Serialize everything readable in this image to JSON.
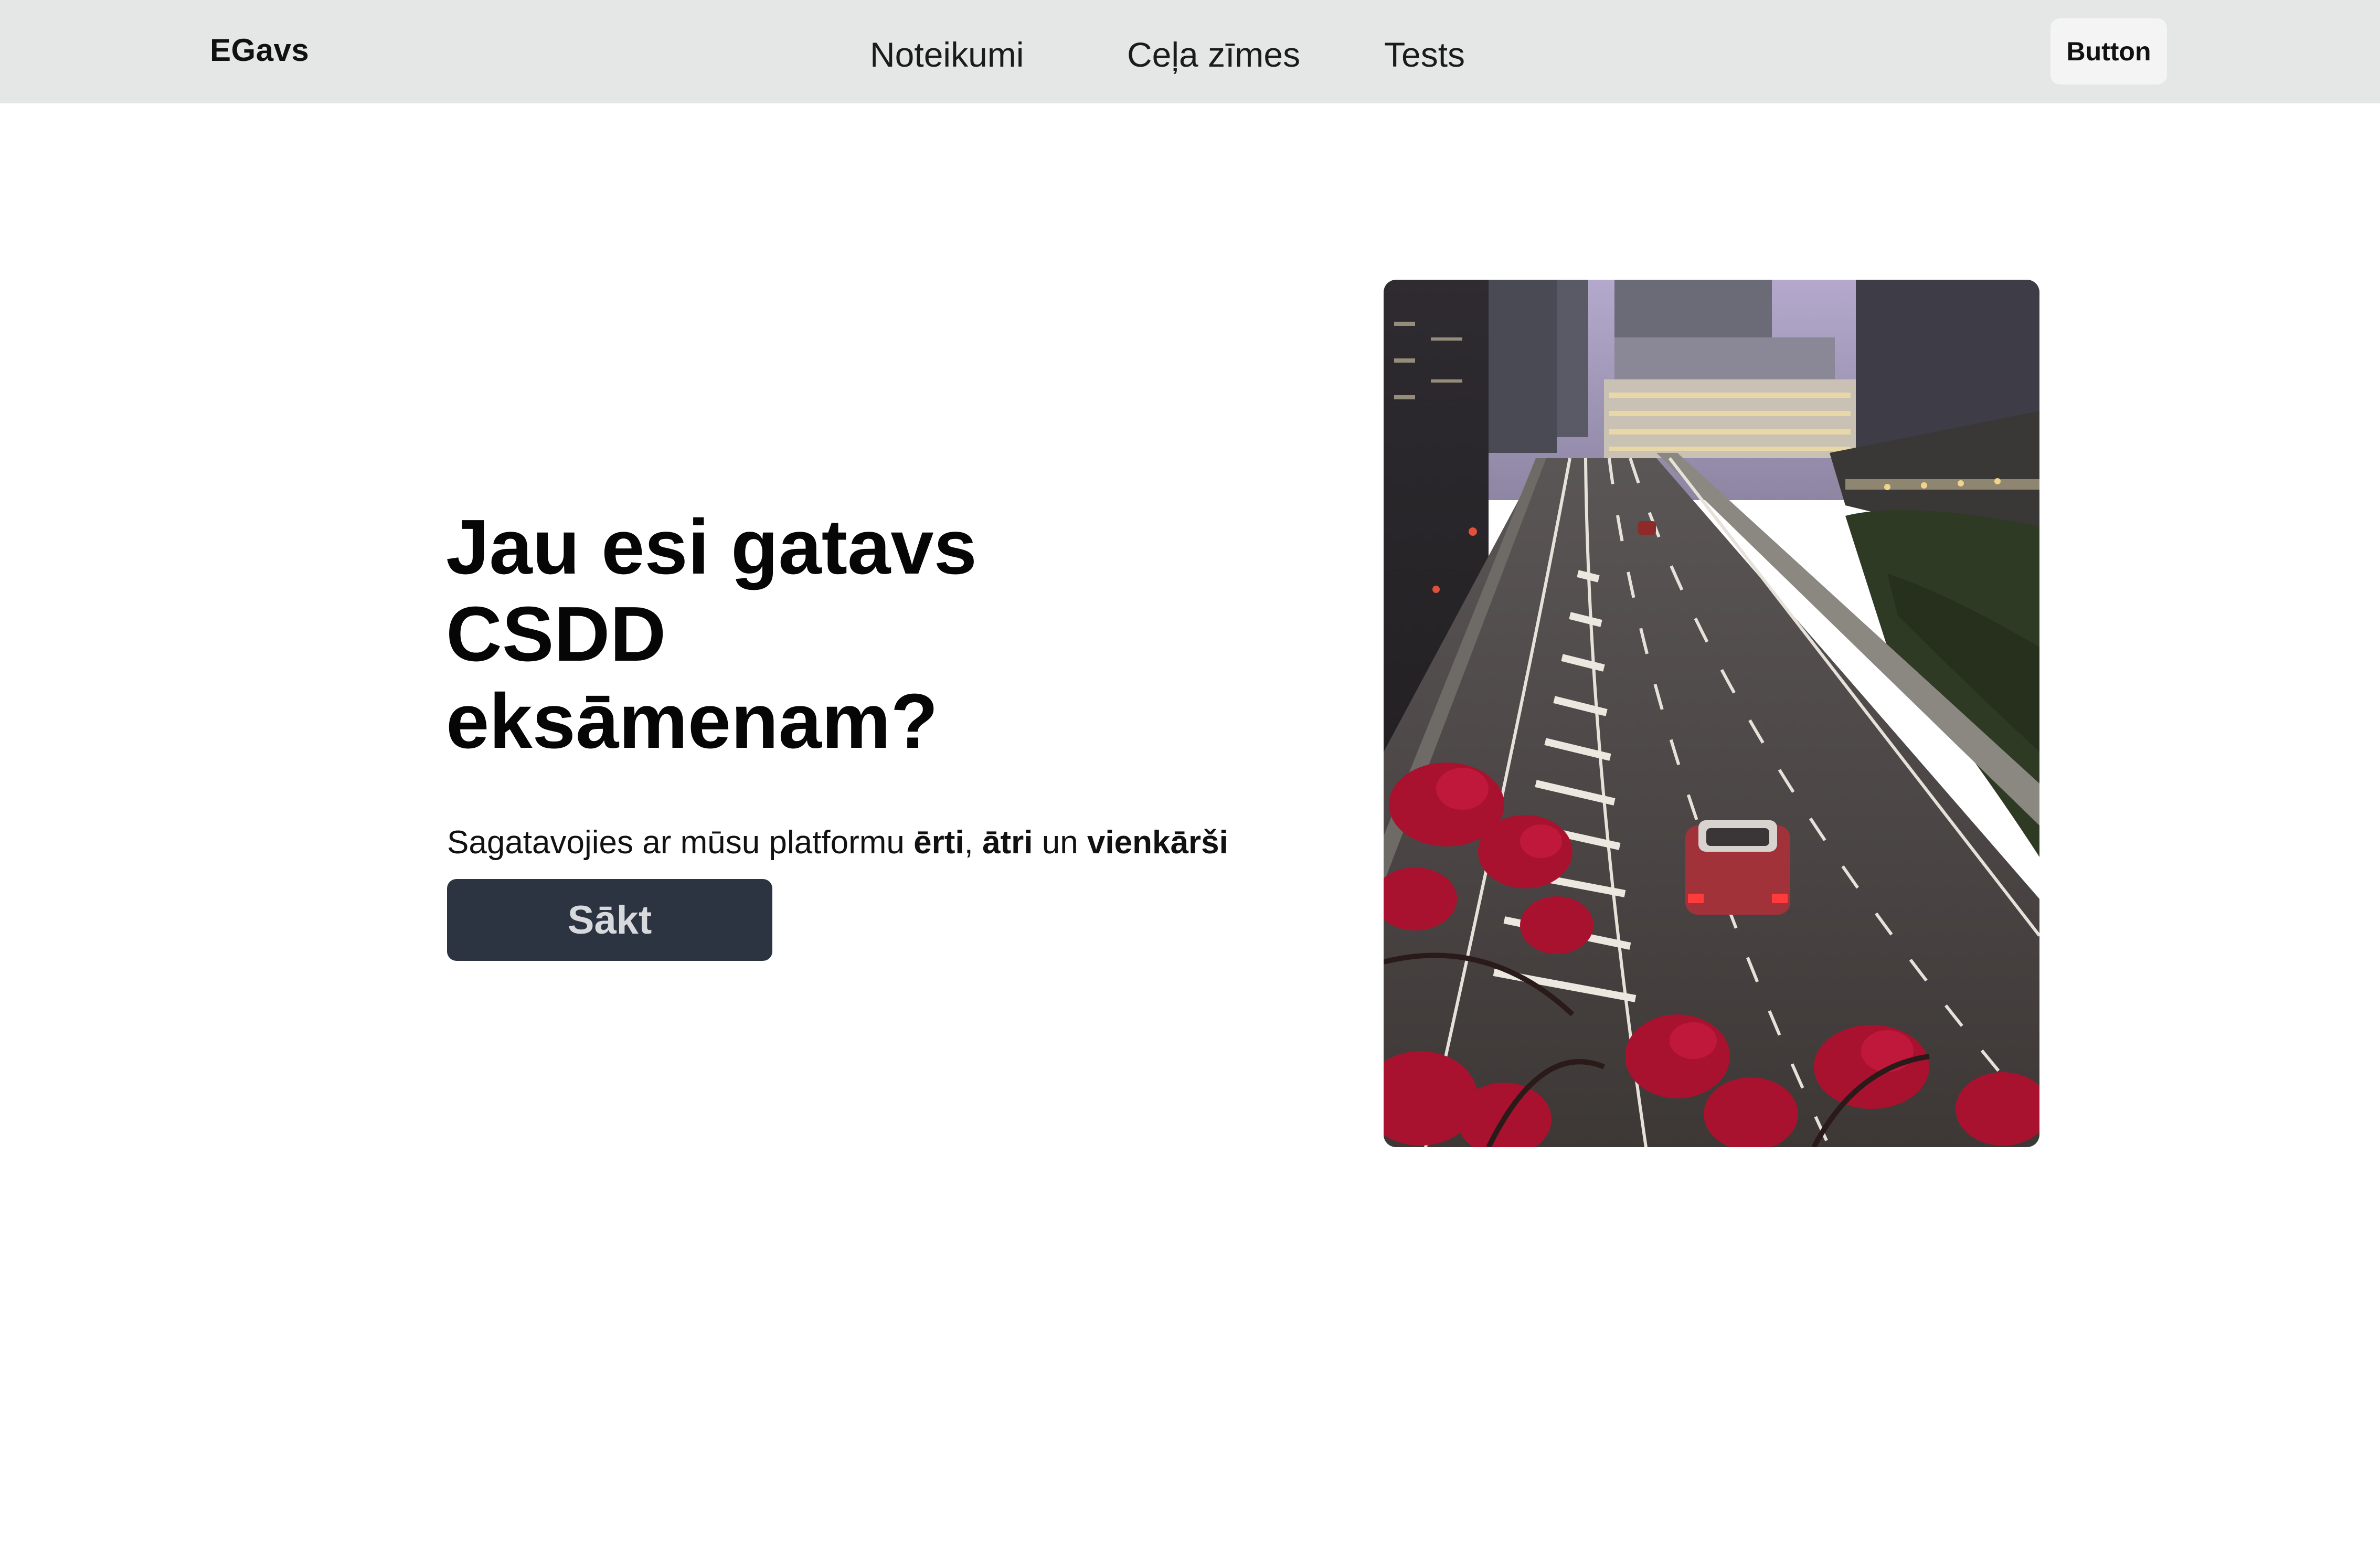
{
  "navbar": {
    "brand": "EGavs",
    "links": [
      {
        "label": "Noteikumi"
      },
      {
        "label": "Ceļa zīmes"
      },
      {
        "label": "Tests"
      }
    ],
    "button_label": "Button"
  },
  "hero": {
    "title": "Jau esi gatavs CSDD eksāmenam?",
    "subtitle": {
      "prefix": "Sagatavojies ar mūsu platformu ",
      "word1": "ērti",
      "sep1": ", ",
      "word2": "ātri",
      "sep2": " un ",
      "word3": "vienkārši"
    },
    "cta_label": "Sākt",
    "image": {
      "description_icon": "city-highway-photo",
      "colors": {
        "sky": "#a79cc0",
        "road": "#4a4542",
        "flowers": "#a8122f",
        "foliage": "#2f3a24"
      }
    }
  },
  "colors": {
    "navbar_bg": "#e5e7e6",
    "cta_bg": "#2d3441",
    "cta_text": "#d7d9dd",
    "nav_button_bg": "#f4f4f4"
  }
}
